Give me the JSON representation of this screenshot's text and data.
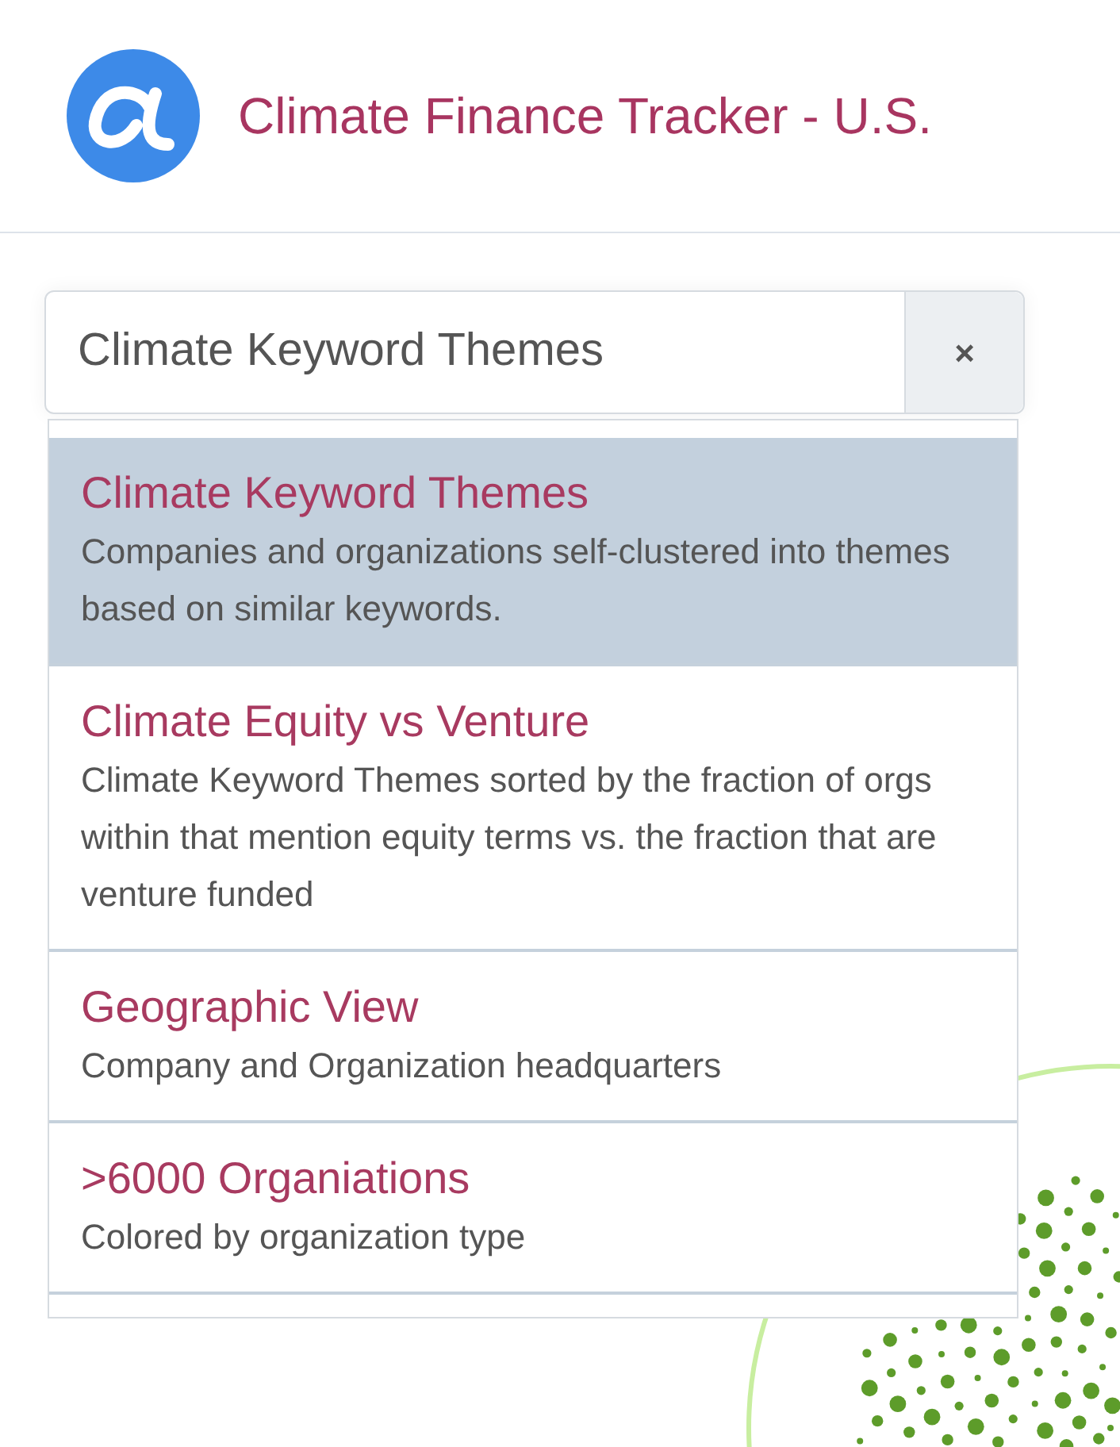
{
  "header": {
    "title": "Climate Finance Tracker - U.S."
  },
  "select": {
    "value": "Climate Keyword Themes",
    "clear_label": "×"
  },
  "options": [
    {
      "title": "Climate Keyword Themes",
      "description": "Companies and organizations self-clustered into themes based on similar keywords.",
      "selected": true
    },
    {
      "title": "Climate Equity vs Venture",
      "description": "Climate Keyword Themes sorted by the fraction of orgs within that mention equity terms vs. the fraction that are venture funded",
      "selected": false
    },
    {
      "title": "Geographic View",
      "description": "Company and Organization headquarters",
      "selected": false
    },
    {
      "title": ">6000 Organiations",
      "description": "Colored by organization type",
      "selected": false
    }
  ]
}
